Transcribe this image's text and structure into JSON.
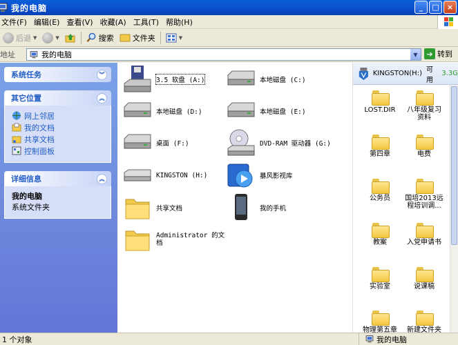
{
  "window": {
    "title": "我的电脑",
    "buttons": [
      "_",
      "□",
      "×"
    ]
  },
  "menu": [
    "文件(F)",
    "编辑(E)",
    "查看(V)",
    "收藏(A)",
    "工具(T)",
    "帮助(H)"
  ],
  "toolbar": {
    "back": "后退",
    "search": "搜索",
    "folders": "文件夹"
  },
  "address": {
    "label": "地址",
    "value": "我的电脑",
    "go": "转到"
  },
  "left": {
    "tasks": {
      "title": "系统任务"
    },
    "places": {
      "title": "其它位置",
      "links": [
        "网上邻居",
        "我的文档",
        "共享文档",
        "控制面板"
      ]
    },
    "details": {
      "title": "详细信息",
      "name": "我的电脑",
      "desc": "系统文件夹"
    }
  },
  "items": [
    {
      "label": "3.5 软盘 (A:)",
      "icon": "floppy-drive-icon"
    },
    {
      "label": "本地磁盘 (C:)",
      "icon": "hard-disk-icon"
    },
    {
      "label": "本地磁盘 (D:)",
      "icon": "hard-disk-icon"
    },
    {
      "label": "本地磁盘 (E:)",
      "icon": "hard-disk-icon"
    },
    {
      "label": "桌面 (F:)",
      "icon": "hard-disk-icon"
    },
    {
      "label": "DVD-RAM 驱动器 (G:)",
      "icon": "dvd-drive-icon"
    },
    {
      "label": "KINGSTON (H:)",
      "icon": "removable-drive-icon"
    },
    {
      "label": "暴风影视库",
      "icon": "media-library-icon"
    },
    {
      "label": "共享文档",
      "icon": "folder-icon"
    },
    {
      "label": "我的手机",
      "icon": "phone-icon"
    },
    {
      "label": "Administrator 的文",
      "label2": "档",
      "icon": "folder-icon"
    }
  ],
  "usb": {
    "name": "KINGSTON(H:)",
    "free_label": "可用",
    "free_value": "3.3G",
    "folders": [
      {
        "l1": "LOST.DIR"
      },
      {
        "l1": "八年级复习",
        "l2": "资料"
      },
      {
        "l1": "第四章"
      },
      {
        "l1": "电费"
      },
      {
        "l1": "公务员"
      },
      {
        "l1": "国培2013远",
        "l2": "程培训调..."
      },
      {
        "l1": "教案"
      },
      {
        "l1": "入党申请书"
      },
      {
        "l1": "实验室"
      },
      {
        "l1": "说课稿"
      },
      {
        "l1": "物理第五章"
      },
      {
        "l1": "新建文件夹"
      }
    ]
  },
  "status": {
    "left": "1 个对象",
    "right": "我的电脑"
  }
}
